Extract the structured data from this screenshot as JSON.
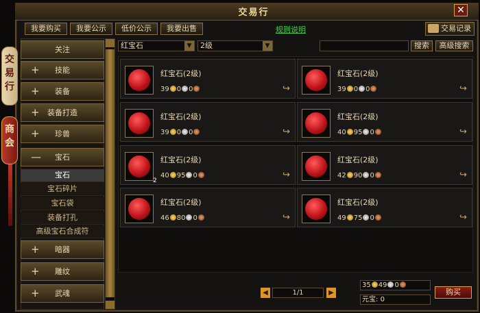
{
  "window": {
    "title": "交易行",
    "close_symbol": "✕"
  },
  "side_tabs": [
    {
      "label": "交易行"
    },
    {
      "label": "商会"
    }
  ],
  "top_tabs": [
    {
      "label": "我要购买"
    },
    {
      "label": "我要公示"
    },
    {
      "label": "低价公示"
    },
    {
      "label": "我要出售"
    }
  ],
  "rules_link": "规则说明",
  "records_button": "交易记录",
  "sidebar": {
    "items": [
      {
        "label": "关注",
        "sign": ""
      },
      {
        "label": "技能",
        "sign": "+"
      },
      {
        "label": "装备",
        "sign": "+"
      },
      {
        "label": "装备打造",
        "sign": "+"
      },
      {
        "label": "珍兽",
        "sign": "+"
      },
      {
        "label": "宝石",
        "sign": "—"
      }
    ],
    "subitems": [
      {
        "label": "宝石",
        "selected": true
      },
      {
        "label": "宝石碎片",
        "selected": false
      },
      {
        "label": "宝石袋",
        "selected": false
      },
      {
        "label": "装备打孔",
        "selected": false
      },
      {
        "label": "高级宝石合成符",
        "selected": false
      }
    ],
    "items_after": [
      {
        "label": "暗器",
        "sign": "+"
      },
      {
        "label": "雕纹",
        "sign": "+"
      },
      {
        "label": "武魂",
        "sign": "+"
      }
    ]
  },
  "filters": {
    "item_select": "红宝石",
    "level_select": "2级",
    "search_value": "",
    "search_button": "搜索",
    "advanced_search_button": "高级搜索"
  },
  "listings": [
    {
      "name": "红宝石(2级)",
      "gold": "39",
      "silver": "0",
      "copper": "0",
      "qty": ""
    },
    {
      "name": "红宝石(2级)",
      "gold": "39",
      "silver": "0",
      "copper": "0",
      "qty": ""
    },
    {
      "name": "红宝石(2级)",
      "gold": "39",
      "silver": "0",
      "copper": "0",
      "qty": ""
    },
    {
      "name": "红宝石(2级)",
      "gold": "40",
      "silver": "95",
      "copper": "0",
      "qty": ""
    },
    {
      "name": "红宝石(2级)",
      "gold": "40",
      "silver": "95",
      "copper": "0",
      "qty": "2"
    },
    {
      "name": "红宝石(2级)",
      "gold": "42",
      "silver": "90",
      "copper": "0",
      "qty": ""
    },
    {
      "name": "红宝石(2级)",
      "gold": "46",
      "silver": "80",
      "copper": "0",
      "qty": ""
    },
    {
      "name": "红宝石(2级)",
      "gold": "49",
      "silver": "75",
      "copper": "0",
      "qty": ""
    }
  ],
  "pager": {
    "prev": "◀",
    "page": "1/1",
    "next": "▶"
  },
  "summary": {
    "gold": "35",
    "silver": "49",
    "copper": "0",
    "yuanbao_label": "元宝:",
    "yuanbao_value": "0"
  },
  "buy_button": "购买",
  "icons": {
    "buy": "↪",
    "dropdown": "▼"
  }
}
